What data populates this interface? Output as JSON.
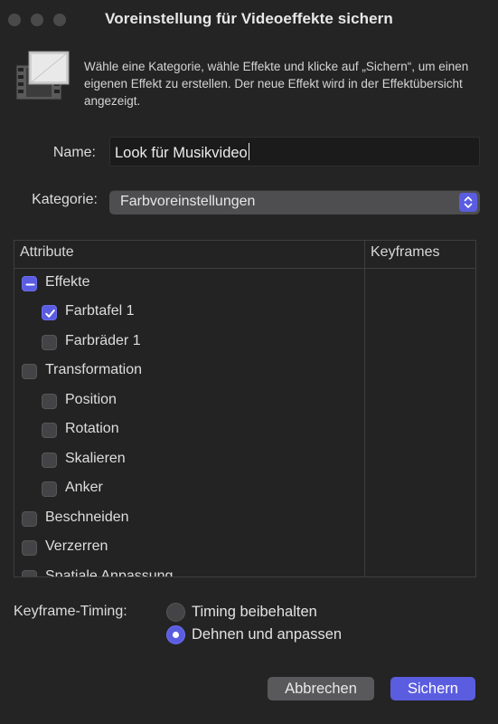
{
  "window": {
    "title": "Voreinstellung für Videoeffekte sichern"
  },
  "header": {
    "icon": "film-effect-icon",
    "description": "Wähle eine Kategorie, wähle Effekte und klicke auf „Sichern“, um einen eigenen Effekt zu erstellen. Der neue Effekt wird in der Effektübersicht angezeigt."
  },
  "form": {
    "name_label": "Name:",
    "name_value": "Look für Musikvideo",
    "category_label": "Kategorie:",
    "category_value": "Farbvoreinstellungen"
  },
  "table": {
    "headers": [
      "Attribute",
      "Keyframes"
    ],
    "rows": [
      {
        "label": "Effekte",
        "level": 0,
        "state": "mixed"
      },
      {
        "label": "Farbtafel 1",
        "level": 1,
        "state": "checked"
      },
      {
        "label": "Farbräder 1",
        "level": 1,
        "state": "unchecked"
      },
      {
        "label": "Transformation",
        "level": 0,
        "state": "unchecked"
      },
      {
        "label": "Position",
        "level": 1,
        "state": "unchecked"
      },
      {
        "label": "Rotation",
        "level": 1,
        "state": "unchecked"
      },
      {
        "label": "Skalieren",
        "level": 1,
        "state": "unchecked"
      },
      {
        "label": "Anker",
        "level": 1,
        "state": "unchecked"
      },
      {
        "label": "Beschneiden",
        "level": 0,
        "state": "unchecked"
      },
      {
        "label": "Verzerren",
        "level": 0,
        "state": "unchecked"
      },
      {
        "label": "Spatiale Anpassung",
        "level": 0,
        "state": "unchecked"
      }
    ]
  },
  "keyframe_timing": {
    "label": "Keyframe-Timing:",
    "options": [
      "Timing beibehalten",
      "Dehnen und anpassen"
    ],
    "selected": "Dehnen und anpassen"
  },
  "buttons": {
    "cancel": "Abbrechen",
    "save": "Sichern"
  },
  "colors": {
    "accent": "#5b5de0",
    "background": "#242424"
  }
}
